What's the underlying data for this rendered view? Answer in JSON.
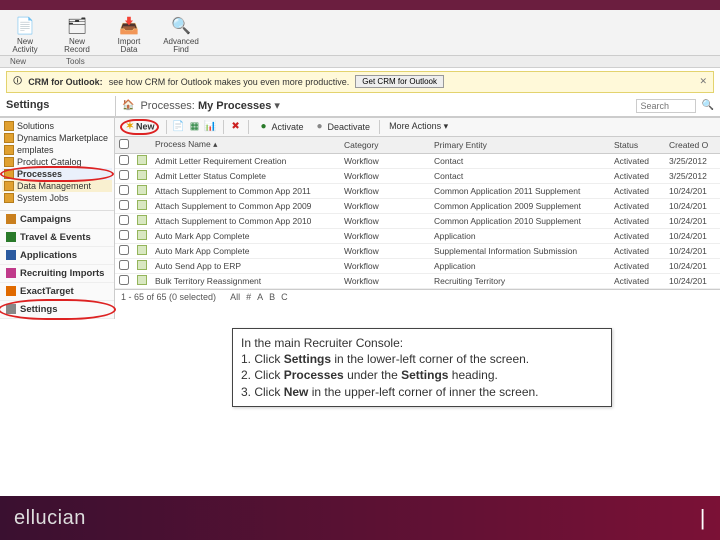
{
  "ribbon": {
    "items": [
      {
        "label": "New Activity",
        "glyph": "📄"
      },
      {
        "label": "New Record",
        "glyph": "🗂"
      },
      {
        "label": "Import Data",
        "glyph": "📥"
      },
      {
        "label": "Advanced Find",
        "glyph": "🔍"
      }
    ],
    "groups": [
      "New",
      "Tools"
    ]
  },
  "promo": {
    "title": "CRM for Outlook:",
    "text": "see how CRM for Outlook makes you even more productive.",
    "button": "Get CRM for Outlook"
  },
  "settings": {
    "heading": "Settings",
    "tree": [
      {
        "label": "Solutions"
      },
      {
        "label": "Dynamics Marketplace"
      },
      {
        "label": "emplates"
      },
      {
        "label": "Product Catalog"
      },
      {
        "label": "Processes",
        "circled": true,
        "bold": true
      },
      {
        "label": "Data Management"
      },
      {
        "label": "System Jobs"
      }
    ],
    "nav": [
      {
        "label": "Campaigns",
        "color": "#c97f1e"
      },
      {
        "label": "Travel & Events",
        "color": "#2a7a2a"
      },
      {
        "label": "Applications",
        "color": "#2a5aa0"
      },
      {
        "label": "Recruiting Imports",
        "color": "#c03a8a"
      },
      {
        "label": "ExactTarget",
        "color": "#e06a00"
      },
      {
        "label": "Settings",
        "color": "#888",
        "circled": true
      }
    ]
  },
  "main": {
    "title_prefix": "Processes:",
    "title_view": "My Processes",
    "search_placeholder": "Search",
    "toolbar": {
      "new": "New",
      "activate": "Activate",
      "deactivate": "Deactivate",
      "more": "More Actions ▾"
    },
    "columns": [
      "",
      "",
      "Process Name ▴",
      "Category",
      "Primary Entity",
      "Status",
      "Created O"
    ],
    "rows": [
      {
        "name": "Admit Letter Requirement Creation",
        "cat": "Workflow",
        "ent": "Contact",
        "st": "Activated",
        "dt": "3/25/2012"
      },
      {
        "name": "Admit Letter Status Complete",
        "cat": "Workflow",
        "ent": "Contact",
        "st": "Activated",
        "dt": "3/25/2012"
      },
      {
        "name": "Attach Supplement to Common App 2011",
        "cat": "Workflow",
        "ent": "Common Application 2011 Supplement",
        "st": "Activated",
        "dt": "10/24/201"
      },
      {
        "name": "Attach Supplement to Common App 2009",
        "cat": "Workflow",
        "ent": "Common Application 2009 Supplement",
        "st": "Activated",
        "dt": "10/24/201"
      },
      {
        "name": "Attach Supplement to Common App 2010",
        "cat": "Workflow",
        "ent": "Common Application 2010 Supplement",
        "st": "Activated",
        "dt": "10/24/201"
      },
      {
        "name": "Auto Mark App Complete",
        "cat": "Workflow",
        "ent": "Application",
        "st": "Activated",
        "dt": "10/24/201"
      },
      {
        "name": "Auto Mark App Complete",
        "cat": "Workflow",
        "ent": "Supplemental Information Submission",
        "st": "Activated",
        "dt": "10/24/201"
      },
      {
        "name": "Auto Send App to ERP",
        "cat": "Workflow",
        "ent": "Application",
        "st": "Activated",
        "dt": "10/24/201"
      },
      {
        "name": "Bulk Territory Reassignment",
        "cat": "Workflow",
        "ent": "Recruiting Territory",
        "st": "Activated",
        "dt": "10/24/201"
      }
    ],
    "pager": {
      "status": "1 - 65 of 65 (0 selected)",
      "letters": [
        "All",
        "#",
        "A",
        "B",
        "C"
      ]
    }
  },
  "callout": {
    "l1": "In the main Recruiter Console:",
    "l2a": "1. Click ",
    "l2b": "Settings",
    "l2c": " in the lower-left corner of the screen.",
    "l3a": "2. Click ",
    "l3b": "Processes",
    "l3c": " under the ",
    "l3d": "Settings",
    "l3e": " heading.",
    "l4a": "3. Click ",
    "l4b": "New",
    "l4c": " in the upper-left corner of inner the screen."
  },
  "footer": {
    "brand": "ellucian"
  }
}
